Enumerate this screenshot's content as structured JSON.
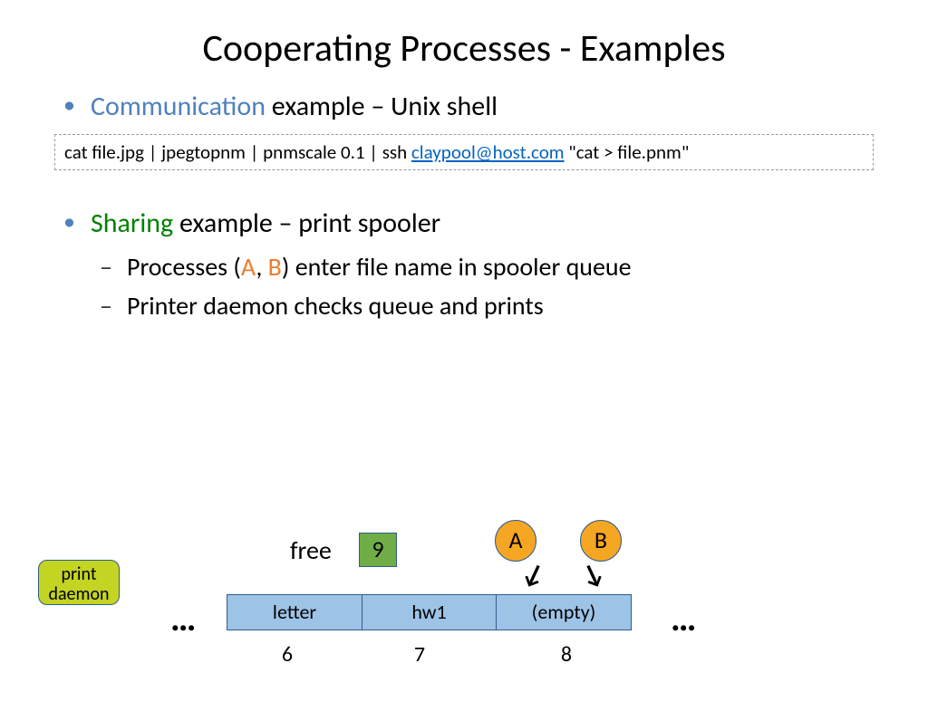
{
  "title": "Cooperating Processes - Examples",
  "bullet_comm_hl": "Communication",
  "bullet_comm_rest": " example – Unix shell",
  "cmd_pre": "cat file.jpg | jpegtopnm | pnmscale 0.1 | ssh ",
  "cmd_link": "claypool@host.com",
  "cmd_post": " \"cat  > file.pnm\"",
  "bullet_share_hl": "Sharing",
  "bullet_share_rest": " example – print spooler",
  "sub1_pre": "Processes (",
  "sub1_A": "A",
  "sub1_mid": ", ",
  "sub1_B": "B",
  "sub1_post": ") enter file name in spooler queue",
  "sub2": "Printer daemon checks queue and prints",
  "diagram": {
    "daemon": "print daemon",
    "free_label": "free",
    "free_val": "9",
    "procA": "A",
    "procB": "B",
    "dots": "…",
    "cells": [
      "letter",
      "hw1",
      "(empty)"
    ],
    "idx": [
      "6",
      "7",
      "8"
    ]
  }
}
